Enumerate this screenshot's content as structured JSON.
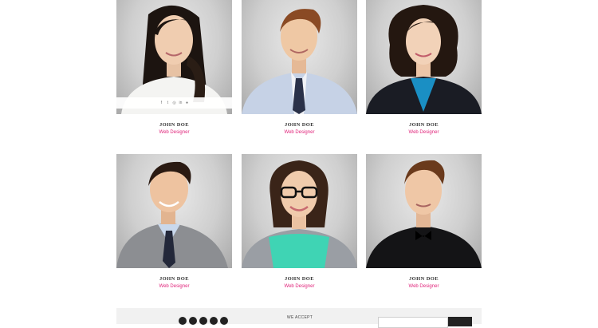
{
  "team": {
    "members": [
      {
        "name": "JOHN DOE",
        "role": "Web Designer"
      },
      {
        "name": "JOHN DOE",
        "role": "Web Designer"
      },
      {
        "name": "JOHN DOE",
        "role": "Web Designer"
      },
      {
        "name": "JOHN DOE",
        "role": "Web Designer"
      },
      {
        "name": "JOHN DOE",
        "role": "Web Designer"
      },
      {
        "name": "JOHN DOE",
        "role": "Web Designer"
      }
    ],
    "social_icons": [
      {
        "glyph": "f",
        "icon": "facebook-icon"
      },
      {
        "glyph": "t",
        "icon": "twitter-icon"
      },
      {
        "glyph": "◎",
        "icon": "dribbble-icon"
      },
      {
        "glyph": "in",
        "icon": "linkedin-icon"
      },
      {
        "glyph": "●",
        "icon": "google-plus-icon"
      }
    ]
  },
  "footer": {
    "accept_label": "WE ACCEPT"
  },
  "colors": {
    "accent": "#e0237a",
    "name_text": "#333333",
    "footer_bg": "#f1f1f1"
  }
}
